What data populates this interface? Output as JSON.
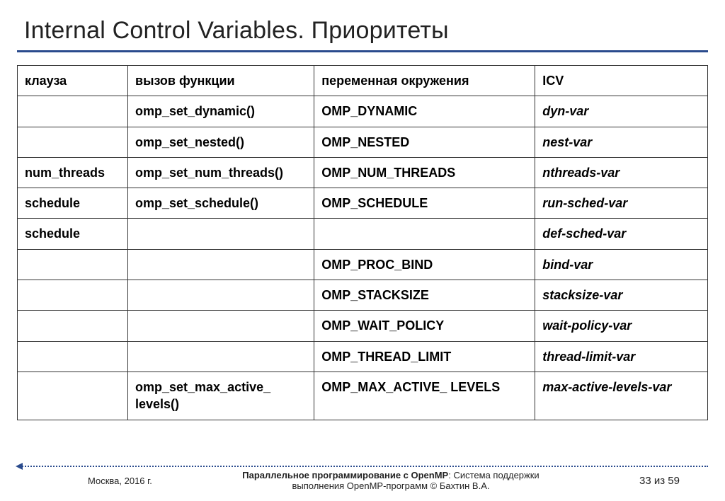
{
  "title": "Internal Control Variables. Приоритеты",
  "headers": {
    "clause": "клауза",
    "call": "вызов функции",
    "env": "переменная окружения",
    "icv": "ICV"
  },
  "rows": [
    {
      "clause": "",
      "call": "omp_set_dynamic()",
      "env": "OMP_DYNAMIC",
      "icv": "dyn-var"
    },
    {
      "clause": "",
      "call": "omp_set_nested()",
      "env": "OMP_NESTED",
      "icv": "nest-var"
    },
    {
      "clause": "num_threads",
      "call": "omp_set_num_threads()",
      "env": "OMP_NUM_THREADS",
      "icv": "nthreads-var"
    },
    {
      "clause": "schedule",
      "call": "omp_set_schedule()",
      "env": "OMP_SCHEDULE",
      "icv": "run-sched-var"
    },
    {
      "clause": "schedule",
      "call": "",
      "env": "",
      "icv": "def-sched-var"
    },
    {
      "clause": "",
      "call": "",
      "env": "OMP_PROC_BIND",
      "icv": "bind-var"
    },
    {
      "clause": "",
      "call": "",
      "env": "OMP_STACKSIZE",
      "icv": "stacksize-var"
    },
    {
      "clause": "",
      "call": "",
      "env": "OMP_WAIT_POLICY",
      "icv": "wait-policy-var"
    },
    {
      "clause": "",
      "call": "",
      "env": "OMP_THREAD_LIMIT",
      "icv": "thread-limit-var"
    },
    {
      "clause": "",
      "call": "omp_set_max_active_ levels()",
      "env": "OMP_MAX_ACTIVE_ LEVELS",
      "icv": "max-active-levels-var"
    }
  ],
  "footer": {
    "left": "Москва, 2016 г.",
    "mid_bold": "Параллельное программирование с OpenMP",
    "mid_rest": ": Система поддержки выполнения OpenMP-программ © Бахтин В.А.",
    "page": "33 из 59"
  }
}
